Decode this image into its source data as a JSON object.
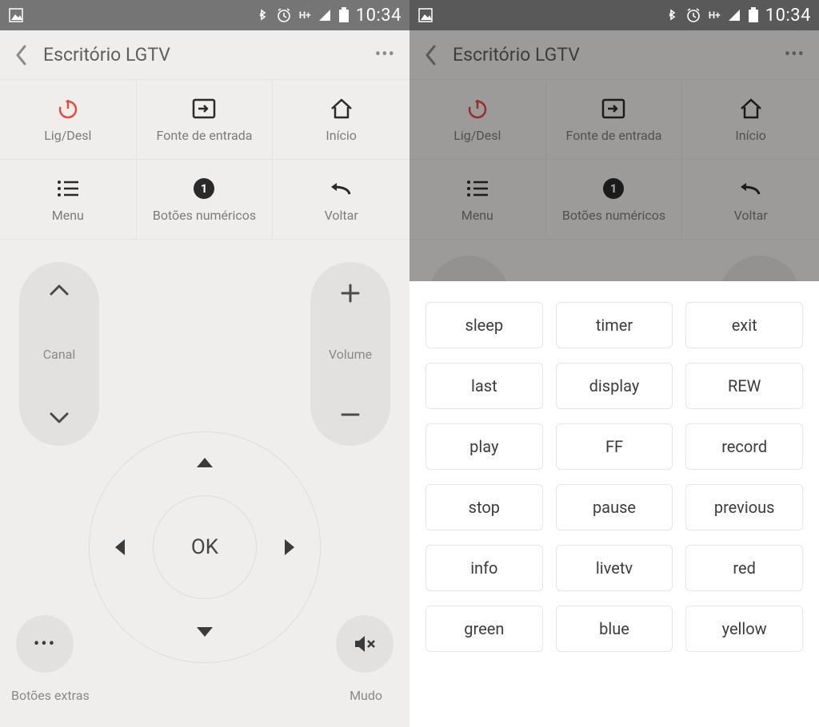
{
  "status": {
    "time": "10:34"
  },
  "header": {
    "title": "Escritório LGTV"
  },
  "grid": {
    "power": "Lig/Desl",
    "input": "Fonte de entrada",
    "home": "Início",
    "menu": "Menu",
    "numeric": "Botões numéricos",
    "back": "Voltar"
  },
  "rockers": {
    "channel": "Canal",
    "volume": "Volume"
  },
  "dpad": {
    "ok": "OK"
  },
  "bottom": {
    "extras": "Botões extras",
    "mute": "Mudo"
  },
  "extra_buttons": [
    "sleep",
    "timer",
    "exit",
    "last",
    "display",
    "REW",
    "play",
    "FF",
    "record",
    "stop",
    "pause",
    "previous",
    "info",
    "livetv",
    "red",
    "green",
    "blue",
    "yellow"
  ]
}
